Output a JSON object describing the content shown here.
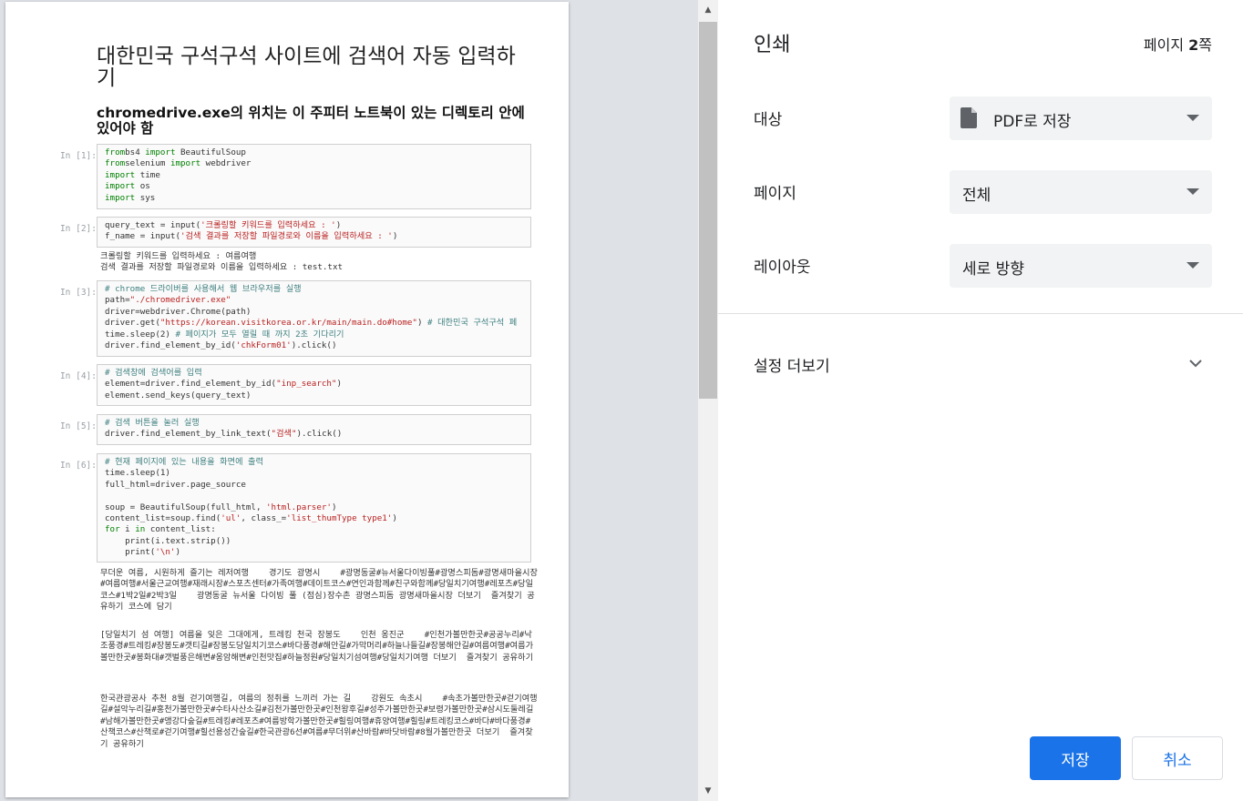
{
  "preview": {
    "title": "대한민국 구석구석 사이트에 검색어 자동 입력하기",
    "subtitle": "chromedrive.exe의 위치는 이 주피터 노트북이 있는 디렉토리 안에 있어야 함",
    "cells": [
      {
        "prompt": "In [1]:",
        "lines": [
          [
            [
              "kw",
              "from"
            ],
            [
              "",
              "bs4 "
            ],
            [
              "kw",
              "import"
            ],
            [
              "",
              " BeautifulSoup"
            ]
          ],
          [
            [
              "kw",
              "from"
            ],
            [
              "",
              "selenium "
            ],
            [
              "kw",
              "import"
            ],
            [
              "",
              " webdriver"
            ]
          ],
          [
            [
              "kw",
              "import"
            ],
            [
              "",
              " time"
            ]
          ],
          [
            [
              "kw",
              "import"
            ],
            [
              "",
              " os"
            ]
          ],
          [
            [
              "kw",
              "import"
            ],
            [
              "",
              " sys"
            ]
          ]
        ]
      },
      {
        "prompt": "In [2]:",
        "lines": [
          [
            [
              "",
              "query_text = input("
            ],
            [
              "str",
              "'크롤링할 키워드를 입력하세요 : '"
            ],
            [
              "",
              ")"
            ]
          ],
          [
            [
              "",
              "f_name = input("
            ],
            [
              "str",
              "'검색 결과를 저장할 파일경로와 이름을 입력하세요 : '"
            ],
            [
              "",
              ")"
            ]
          ]
        ]
      },
      {
        "prompt": "In [3]:",
        "lines": [
          [
            [
              "cm",
              "# chrome 드라이버를 사용해서 웹 브라우저를 실행"
            ]
          ],
          [
            [
              "",
              "path="
            ],
            [
              "str",
              "\"./chromedriver.exe\""
            ]
          ],
          [
            [
              "",
              "driver=webdriver.Chrome(path)"
            ]
          ],
          [
            [
              "",
              "driver.get("
            ],
            [
              "str",
              "\"https://korean.visitkorea.or.kr/main/main.do#home\""
            ],
            [
              "",
              ") "
            ],
            [
              "cm",
              "# 대한민국 구석구석 페"
            ]
          ],
          [
            [
              "",
              "time.sleep(2) "
            ],
            [
              "cm",
              "# 페이지가 모두 열릴 때 까지 2초 기다리기"
            ]
          ],
          [
            [
              "",
              "driver.find_element_by_id("
            ],
            [
              "str",
              "'chkForm01'"
            ],
            [
              "",
              ").click()"
            ]
          ]
        ]
      },
      {
        "prompt": "In [4]:",
        "lines": [
          [
            [
              "cm",
              "# 검색창에 검색어를 입력"
            ]
          ],
          [
            [
              "",
              "element=driver.find_element_by_id("
            ],
            [
              "str",
              "\"inp_search\""
            ],
            [
              "",
              ")"
            ]
          ],
          [
            [
              "",
              "element.send_keys(query_text)"
            ]
          ]
        ]
      },
      {
        "prompt": "In [5]:",
        "lines": [
          [
            [
              "cm",
              "# 검색 버튼을 눌러 실행"
            ]
          ],
          [
            [
              "",
              "driver.find_element_by_link_text("
            ],
            [
              "str",
              "\"검색\""
            ],
            [
              "",
              ").click()"
            ]
          ]
        ]
      },
      {
        "prompt": "In [6]:",
        "lines": [
          [
            [
              "cm",
              "# 현재 페이지에 있는 내용을 화면에 출력"
            ]
          ],
          [
            [
              "",
              "time.sleep(1)"
            ]
          ],
          [
            [
              "",
              "full_html=driver.page_source"
            ]
          ],
          [
            [
              "",
              ""
            ]
          ],
          [
            [
              "",
              "soup = BeautifulSoup(full_html, "
            ],
            [
              "str",
              "'html.parser'"
            ],
            [
              "",
              ")"
            ]
          ],
          [
            [
              "",
              "content_list=soup.find("
            ],
            [
              "str",
              "'ul'"
            ],
            [
              "",
              ", class_="
            ],
            [
              "str",
              "'list_thumType type1'"
            ],
            [
              "",
              ")"
            ]
          ],
          [
            [
              "kw",
              "for"
            ],
            [
              "",
              " i "
            ],
            [
              "kw",
              "in"
            ],
            [
              "",
              " content_list:"
            ]
          ],
          [
            [
              "",
              "    print(i.text.strip())"
            ]
          ],
          [
            [
              "",
              "    print("
            ],
            [
              "str",
              "'\\n'"
            ],
            [
              "",
              ")"
            ]
          ]
        ]
      }
    ],
    "output2": "크롤링할 키워드를 입력하세요 : 여름여행\n검색 결과를 저장할 파일경로와 이름을 입력하세요 : test.txt",
    "output6": [
      "무더운 여름, 시원하게 즐기는 레저여행    경기도 광명시    #광명동굴#뉴서울다이빙풀#광명스피돔#광명새마을시장#여름여행#서울근교여행#재래시장#스포츠센터#가족여행#데이트코스#연인과함께#친구와함께#당일치기여행#레포츠#당일코스#1박2일#2박3일    광명동굴 뉴서울 다이빙 풀 (점심)장수촌 광명스피돔 광명새마을시장 더보기  즐겨찾기 공유하기 코스에 담기",
      "[당일치기 섬 여행] 여름을 잊은 그대에게, 트레킹 천국 장봉도    인천 옹진군    #인천가볼만한곳#공공누리#낙조풍경#트레킹#장봉도#갯티길#장봉도당일치기코스#바다풍경#해안길#가막머리#하늘나들길#장봉해안길#여름여행#여름가볼만한곳#봉화대#갯벌풍은해변#옹암해변#인천맛집#하늘정원#당일치기섬여행#당일치기여행 더보기  즐겨찾기 공유하기",
      "한국관광공사 추천 8월 걷기여행길, 여름의 정취를 느끼러 가는 길    강원도 속초시    #속초가볼만한곳#걷기여행길#설악누리길#홍천가볼만한곳#수타사산소길#김천가볼만한곳#인천왕후길#성주가볼만한곳#보령가볼만한곳#삼시도둘레길#남해가볼만한곳#앵강다숲길#트레킹#레포츠#여름방학가볼만한곳#힐링여행#휴양여행#힐링#트레킹코스#바다#바다풍경#산책코스#산책로#걷기여행#힐선용성간숲길#한국관광6선#여름#무더위#산바람#바닷바람#8월가볼만한곳 더보기  즐겨찾기 공유하기"
    ]
  },
  "sidebar": {
    "title": "인쇄",
    "page_count_prefix": "페이지 ",
    "page_count_number": "2",
    "page_count_suffix": "쪽",
    "destination_label": "대상",
    "destination_value": "PDF로 저장",
    "pages_label": "페이지",
    "pages_value": "전체",
    "layout_label": "레이아웃",
    "layout_value": "세로 방향",
    "more_settings_label": "설정 더보기",
    "save_label": "저장",
    "cancel_label": "취소"
  },
  "icons": {
    "destination": "pdf-document-icon",
    "dropdown": "triangle-down-icon",
    "more_settings": "chevron-down-icon",
    "scroll_up": "scroll-up-arrow-icon",
    "scroll_down": "scroll-down-arrow-icon"
  },
  "colors": {
    "primary": "#1a73e8",
    "select_bg": "#f1f3f4",
    "preview_bg": "#dee1e6",
    "code_keyword": "#008000",
    "code_string": "#ba2121",
    "code_comment": "#408080"
  }
}
